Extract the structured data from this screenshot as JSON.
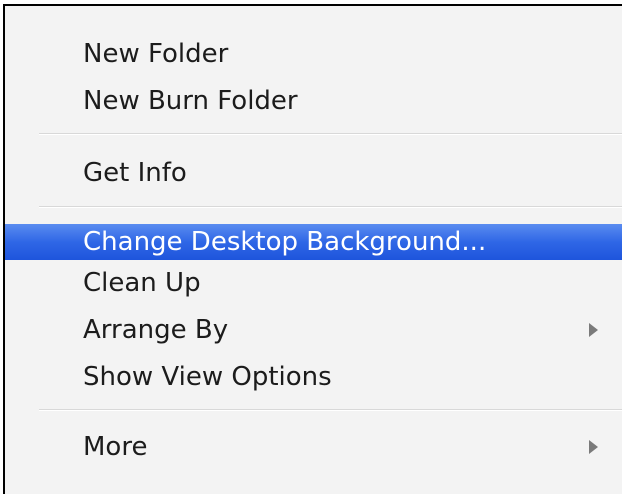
{
  "menu": {
    "items": [
      {
        "label": "New Folder"
      },
      {
        "label": "New Burn Folder"
      },
      {
        "label": "Get Info"
      },
      {
        "label": "Change Desktop Background..."
      },
      {
        "label": "Clean Up"
      },
      {
        "label": "Arrange By",
        "submenu_icon": "submenu-arrow-icon"
      },
      {
        "label": "Show View Options"
      },
      {
        "label": "More",
        "submenu_icon": "submenu-arrow-icon"
      }
    ],
    "highlighted_item": "Change Desktop Background...",
    "colors": {
      "highlight": "#2f67e6",
      "highlight_text": "#ffffff",
      "text": "#1c1c1c",
      "background": "#f3f3f3"
    }
  }
}
